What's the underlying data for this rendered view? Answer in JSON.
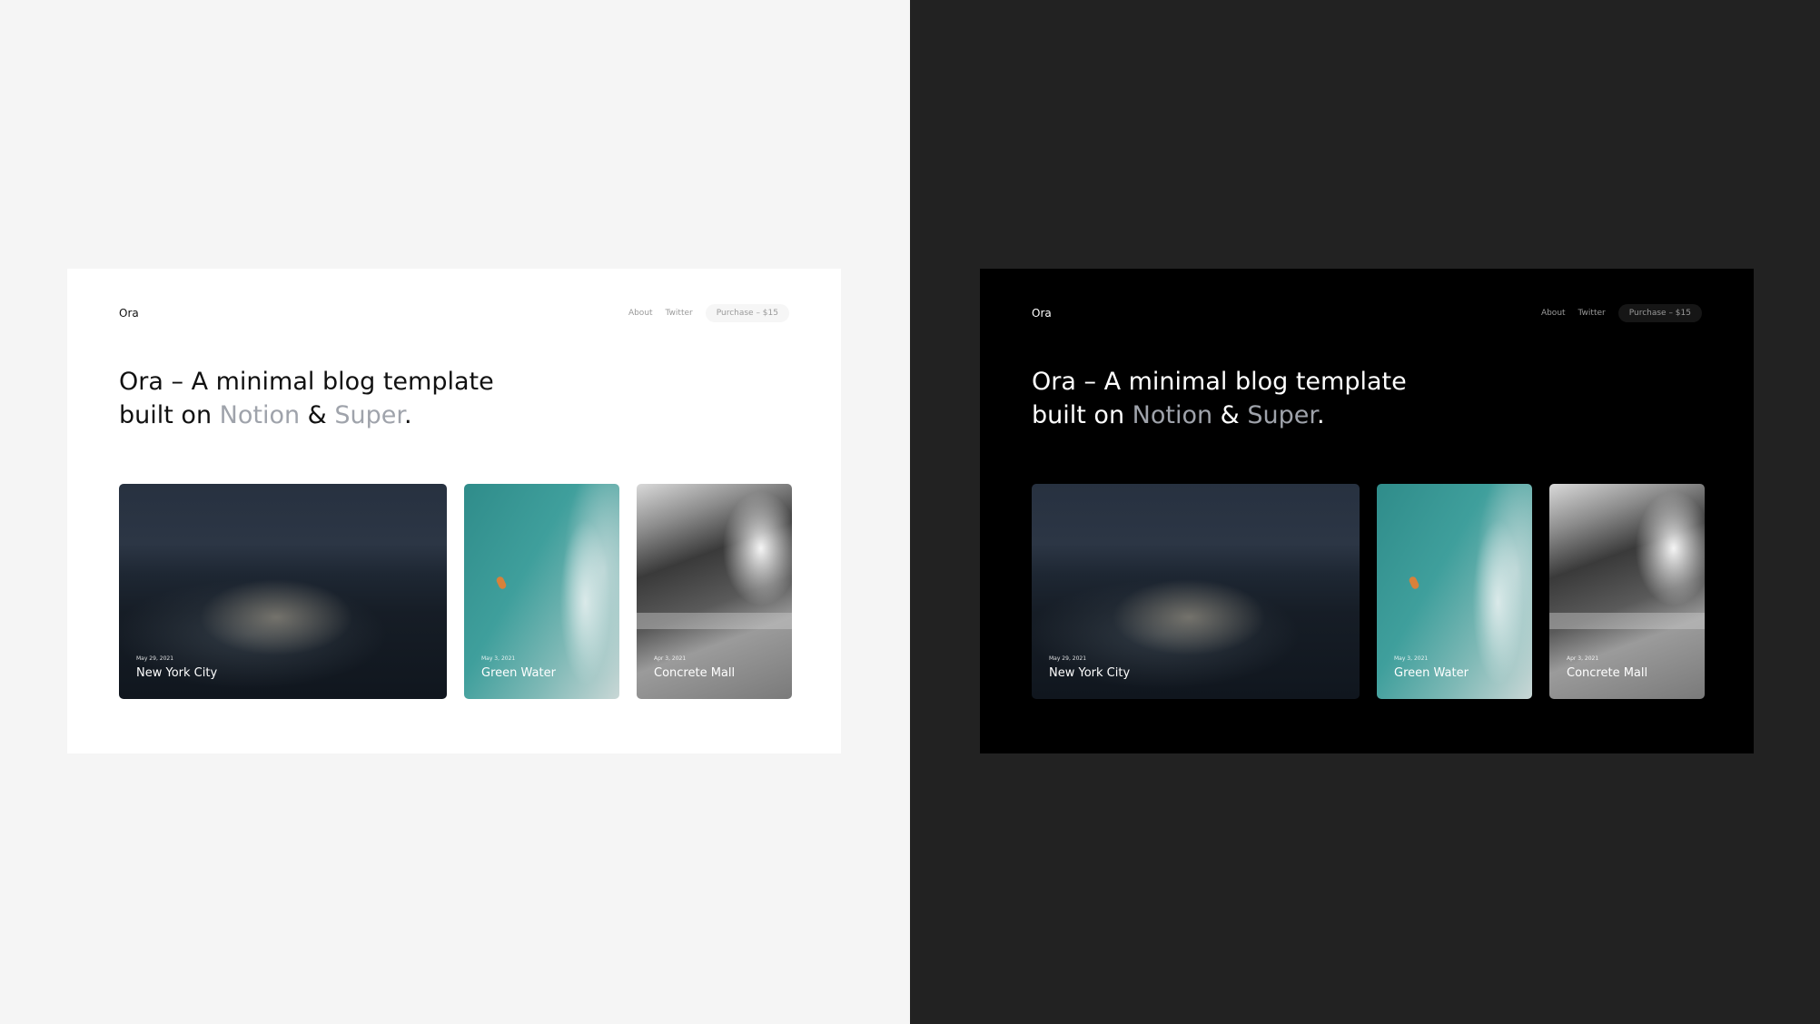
{
  "brand": "Ora",
  "nav": {
    "about": "About",
    "twitter": "Twitter",
    "purchase": "Purchase – $15"
  },
  "headline": {
    "line1": "Ora – A minimal blog template",
    "built_on": "built on ",
    "notion": "Notion",
    "amp": " & ",
    "super": "Super",
    "period": "."
  },
  "cards": [
    {
      "date": "May 29, 2021",
      "title": "New York City"
    },
    {
      "date": "May 3, 2021",
      "title": "Green Water"
    },
    {
      "date": "Apr 3, 2021",
      "title": "Concrete Mall"
    }
  ],
  "colors": {
    "light_bg": "#f5f5f5",
    "dark_bg": "#222222",
    "accent_muted": "#9fa3ab"
  },
  "icons": []
}
